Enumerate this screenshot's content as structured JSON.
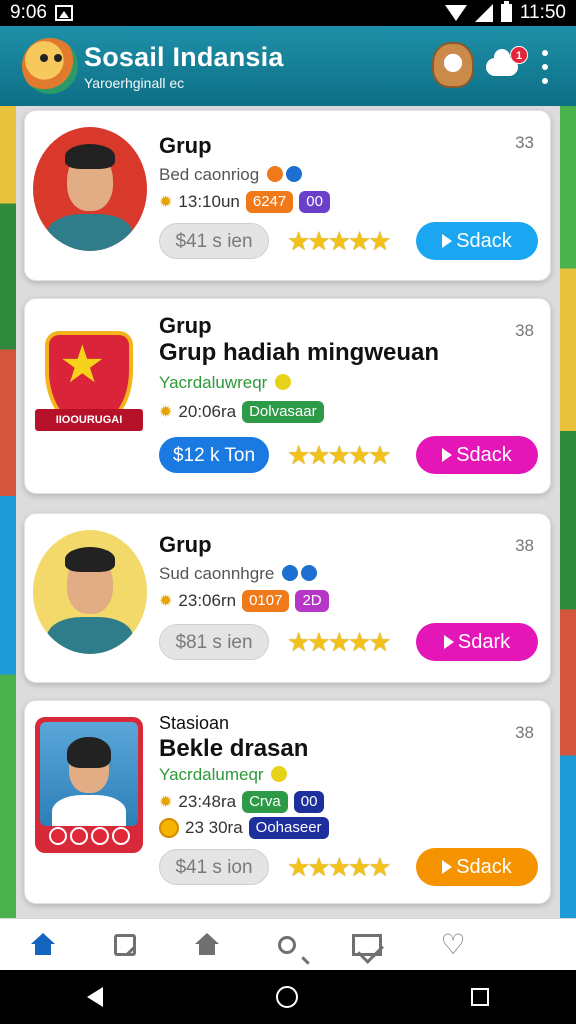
{
  "status_bar": {
    "time_left": "9:06",
    "time_right": "11:50"
  },
  "app": {
    "title": "Sosail Indansia",
    "subtitle": "Yaroerhginall ec",
    "notification_count": "1"
  },
  "cards": [
    {
      "kicker": "Grup",
      "title": "",
      "subtitle": "Bed caonriog",
      "meta1_time": "13:10un",
      "meta1_pill": "6247",
      "meta1_pill2": "00",
      "number": "33",
      "price": "$41 s ien",
      "action": "Sdack",
      "stars": "★★★★★"
    },
    {
      "kicker": "Grup",
      "title": "Grup hadiah mingweuan",
      "subtitle": "Yacrdaluwreqr",
      "meta1_time": "20:06ra",
      "meta1_pill": "Dolvasaar",
      "number": "38",
      "badge_ribbon": "IIOOURUGAI",
      "price": "$12 k Ton",
      "action": "Sdack",
      "stars": "★★★★★"
    },
    {
      "kicker": "Grup",
      "title": "",
      "subtitle": "Sud caonnhgre",
      "meta1_time": "23:06rn",
      "meta1_pill": "0107",
      "meta1_pill2": "2D",
      "number": "38",
      "price": "$81 s ien",
      "action": "Sdark",
      "stars": "★★★★★"
    },
    {
      "kicker": "Stasioan",
      "title": "Bekle drasan",
      "subtitle": "Yacrdalumeqr",
      "meta1_time": "23:48ra",
      "meta1_pill": "Crva",
      "meta1_pill2": "00",
      "meta2_time": "23 30ra",
      "meta2_pill": "Oohaseer",
      "number": "38",
      "price": "$41 s ion",
      "action": "Sdack",
      "stars": "★★★★★"
    }
  ],
  "colors": {
    "appbar": "#1e90a8",
    "action_blue": "#1aa6f0",
    "action_magenta": "#e516b8",
    "action_orange": "#f59300",
    "price_blue": "#1a7ae2",
    "pill_orange": "#f07a1a",
    "pill_green": "#2d9a48",
    "pill_navy": "#1d2f9c"
  },
  "icons": [
    "home-icon",
    "edit-icon",
    "home-icon",
    "search-icon",
    "mail-icon",
    "heart-icon",
    "menu-icon"
  ]
}
